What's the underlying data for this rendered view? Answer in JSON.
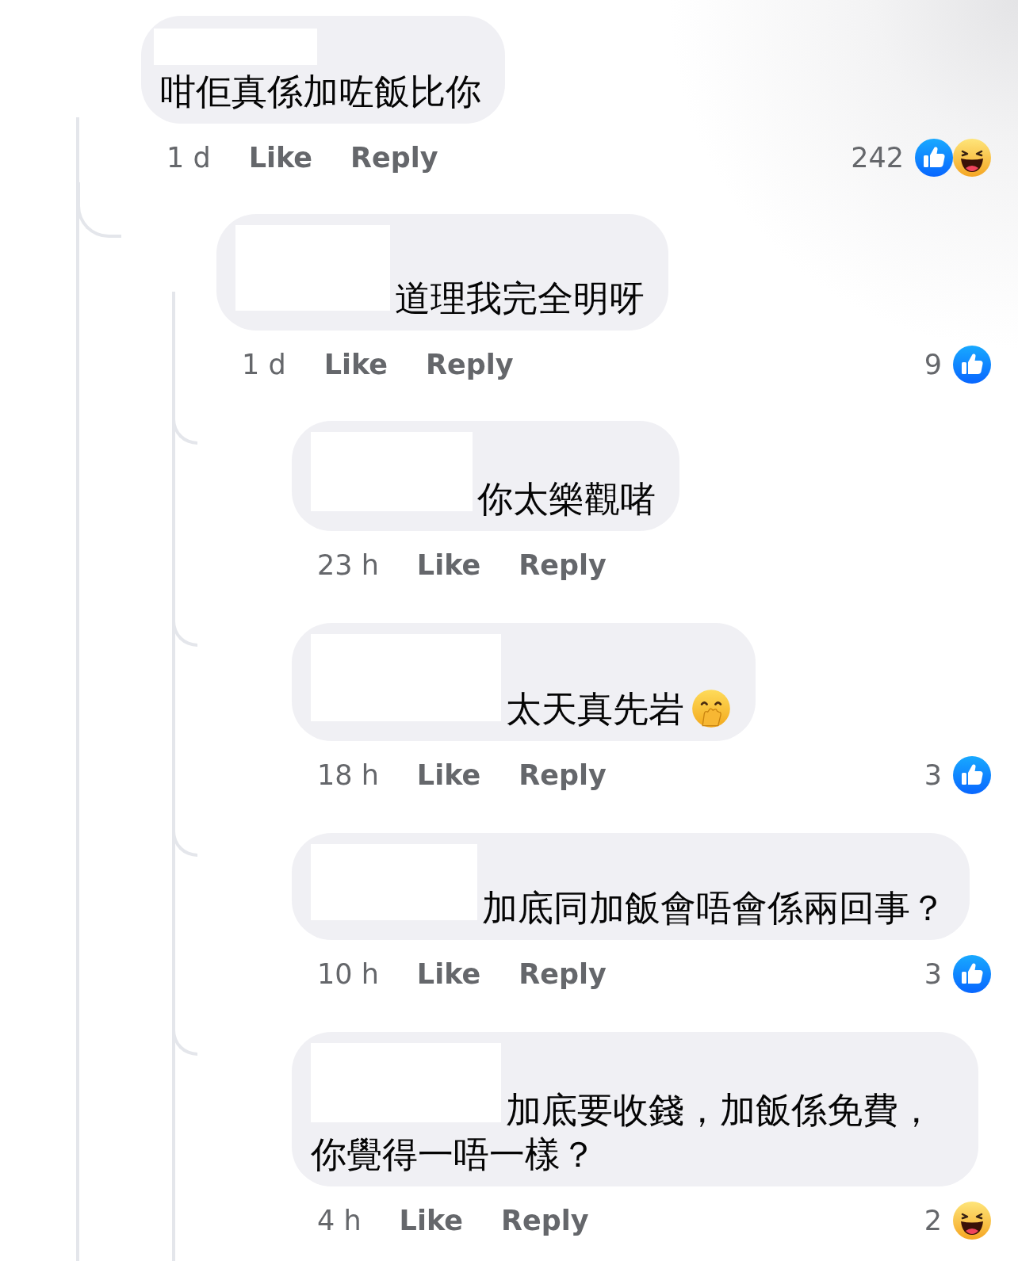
{
  "comments": [
    {
      "text": "咁佢真係加咗飯比你",
      "name_redacted": true,
      "time": "1 d",
      "like_label": "Like",
      "reply_label": "Reply",
      "reaction_count": "242",
      "reactions": [
        {
          "kind": "like"
        },
        {
          "kind": "haha"
        }
      ],
      "replies": [
        {
          "text": "道理我完全明呀",
          "name_redacted": true,
          "time": "1 d",
          "like_label": "Like",
          "reply_label": "Reply",
          "reaction_count": "9",
          "reactions": [
            {
              "kind": "like"
            }
          ],
          "replies": [
            {
              "text": "你太樂觀啫",
              "name_redacted": true,
              "time": "23 h",
              "like_label": "Like",
              "reply_label": "Reply"
            },
            {
              "text": "太天真先岩",
              "emoji": {
                "kind": "hand-over-mouth"
              },
              "name_redacted": true,
              "time": "18 h",
              "like_label": "Like",
              "reply_label": "Reply",
              "reaction_count": "3",
              "reactions": [
                {
                  "kind": "like"
                }
              ]
            },
            {
              "text": "加底同加飯會唔會係兩回事？",
              "name_redacted": true,
              "time": "10 h",
              "like_label": "Like",
              "reply_label": "Reply",
              "reaction_count": "3",
              "reactions": [
                {
                  "kind": "like"
                }
              ]
            },
            {
              "text": "加底要收錢，加飯係免費，你覺得一唔一樣？",
              "name_redacted": true,
              "time": "4 h",
              "like_label": "Like",
              "reply_label": "Reply",
              "reaction_count": "2",
              "reactions": [
                {
                  "kind": "haha"
                }
              ]
            }
          ]
        }
      ]
    }
  ]
}
